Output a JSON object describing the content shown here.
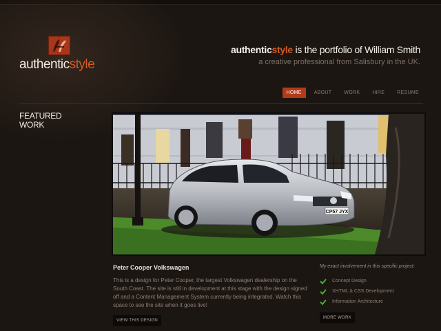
{
  "brand": {
    "logo_word_1": "authentic",
    "logo_word_2": "style",
    "accent_color": "#d25a22"
  },
  "tagline": {
    "brand_1": "authentic",
    "brand_2": "style",
    "rest": "is the portfolio of William Smith",
    "sub": "a creative professional from Salisbury in the UK."
  },
  "nav": {
    "items": [
      "HOME",
      "ABOUT",
      "WORK",
      "HIRE",
      "RESUME"
    ],
    "active": "HOME"
  },
  "featured": {
    "line1": "FEATURED",
    "line2": "WORK"
  },
  "project": {
    "title": "Peter Cooper Volkswagen",
    "description": "This is a design for Peter Cooper, the largest Volkswagen dealership on the South Coast. The site is still in development at this stage with the design signed off and a Content Management System currently being integrated. Watch this space to see the site when it goes live!",
    "view_button": "VIEW THIS DESIGN",
    "plate": "CP57 JYX"
  },
  "involvement": {
    "title": "My exact involvement in this specific project:",
    "items": [
      "Concept Design",
      "XHTML & CSS Development",
      "Information Architecture"
    ],
    "more_button": "MORE WORK",
    "check_color": "#4caa3a"
  }
}
